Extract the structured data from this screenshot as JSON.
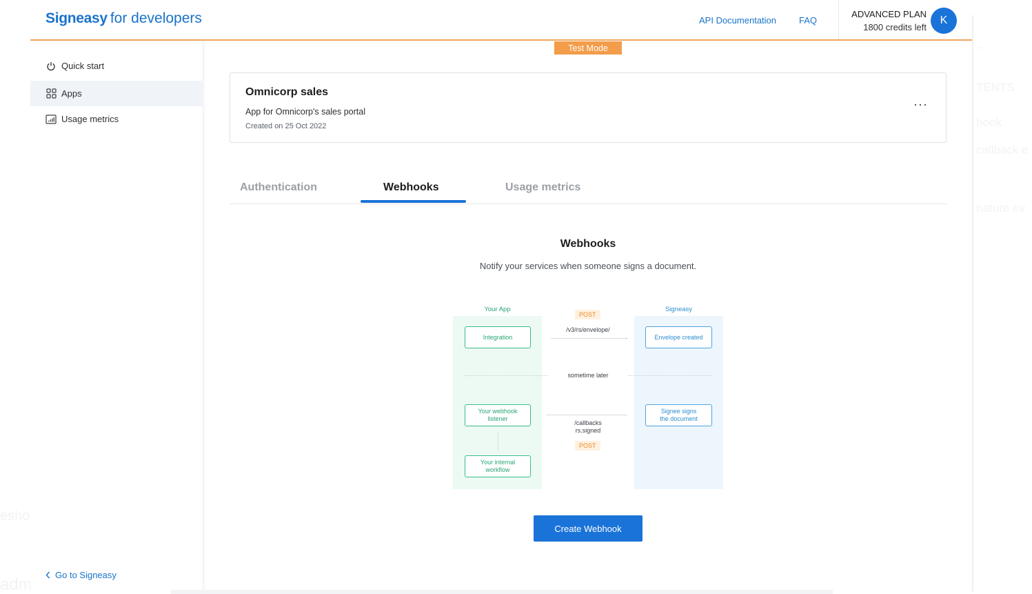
{
  "header": {
    "brand": "Signeasy",
    "brand_suffix": "for developers",
    "links": [
      "API Documentation",
      "FAQ"
    ],
    "plan_name": "ADVANCED PLAN",
    "plan_credits": "1800 credits left",
    "avatar_initial": "K"
  },
  "sidebar": {
    "items": [
      {
        "label": "Quick start",
        "icon": "power-icon",
        "active": false
      },
      {
        "label": "Apps",
        "icon": "grid-icon",
        "active": true
      },
      {
        "label": "Usage metrics",
        "icon": "bar-chart-icon",
        "active": false
      }
    ],
    "back_link": "Go to Signeasy"
  },
  "main": {
    "mode_badge": "Test Mode",
    "app": {
      "name": "Omnicorp sales",
      "description": "App for Omnicorp's sales portal",
      "created": "Created on 25 Oct 2022",
      "menu": "···"
    },
    "tabs": [
      {
        "label": "Authentication",
        "active": false
      },
      {
        "label": "Webhooks",
        "active": true
      },
      {
        "label": "Usage metrics",
        "active": false
      }
    ],
    "webhooks": {
      "title": "Webhooks",
      "subtitle": "Notify your services when someone signs a document.",
      "diagram": {
        "left_label": "Your App",
        "right_label": "Signeasy",
        "post_top": "POST",
        "endpoint": "/v3/rs/envelope/",
        "integration": "Integration",
        "envelope_created": "Envelope created",
        "later": "sometime later",
        "listener_line1": "Your webhook",
        "listener_line2": "listener",
        "signee_line1": "Signee signs",
        "signee_line2": "the document",
        "callback_line1": "/callbacks",
        "callback_line2": "rs.signed",
        "post_bottom": "POST",
        "workflow_line1": "Your internal",
        "workflow_line2": "workflow"
      },
      "cta": "Create Webhook"
    }
  },
  "background": {
    "ghost_texts": [
      "TENTS",
      "hook",
      "callback e",
      "nature ev",
      "esho",
      "adm"
    ]
  },
  "colors": {
    "accent": "#1a73d8",
    "test_mode": "#f39c4a",
    "header_rule": "#f0a55b",
    "green": "#3bbd8a",
    "blue": "#4da3de"
  }
}
